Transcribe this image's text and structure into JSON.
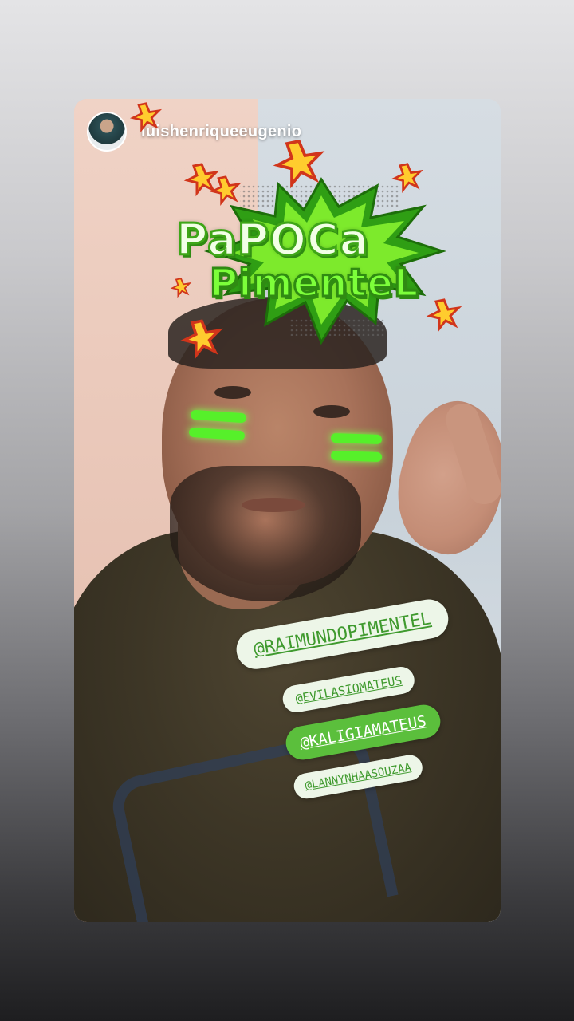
{
  "story": {
    "username": "luishenriqueeugenio",
    "sticker_title_line1": "PaPOCa",
    "sticker_title_line2": "PimenteL",
    "mentions": [
      {
        "handle": "@RAIMUNDOPIMENTEL"
      },
      {
        "handle": "@EVILASIOMATEUS"
      },
      {
        "handle": "@KALIGIAMATEUS"
      },
      {
        "handle": "@LANNYNHAASOUZAA"
      }
    ]
  },
  "colors": {
    "sticker_green": "#56f02a",
    "mention_text_green": "#3f9a2e",
    "mention_highlight_bg": "#5bbf3c"
  },
  "icons": [
    "avatar",
    "explosion-sticker-icon",
    "burst-star-icon"
  ]
}
